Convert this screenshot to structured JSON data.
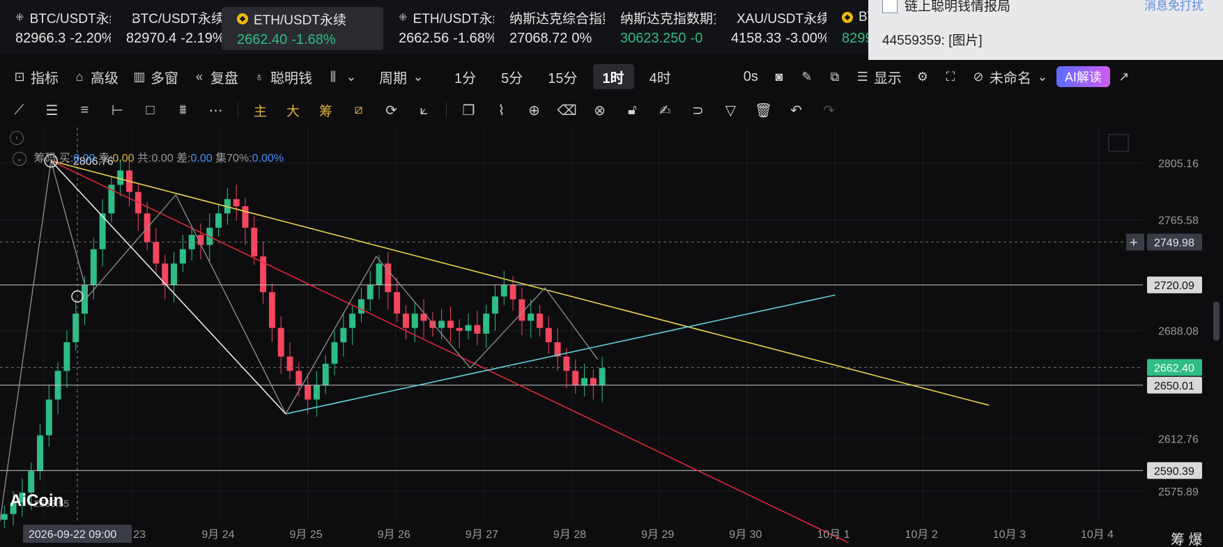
{
  "tickers": [
    {
      "name": "BTC/USDT永续",
      "price": "82966.3",
      "change": "-2.20%",
      "icon": "x-icon"
    },
    {
      "name": "BTC/USDT永续",
      "price": "82970.4",
      "change": "-2.19%",
      "icon": "binance-icon"
    },
    {
      "name": "ETH/USDT永续",
      "price": "2662.40",
      "change": "-1.68%",
      "icon": "binance-icon",
      "active": true
    },
    {
      "name": "ETH/USDT永续",
      "price": "2662.56",
      "change": "-1.68%",
      "icon": "x-icon"
    },
    {
      "name": "纳斯达克综合指数",
      "price": "27068.72",
      "change": "0%",
      "icon": ""
    },
    {
      "name": "纳斯达克指数期货",
      "price": "30623.250",
      "change": "-0",
      "icon": "",
      "green": true
    },
    {
      "name": "XAU/USDT永续",
      "price": "4158.33",
      "change": "-3.00%",
      "icon": "binance-icon"
    },
    {
      "name": "BTC",
      "price": "8299",
      "change": "",
      "icon": "binance-icon",
      "green": true
    }
  ],
  "notification": {
    "title": "链上聪明钱情报局",
    "dismiss": "消息免打扰",
    "body": "44559359: [图片]"
  },
  "toolbar": {
    "indicators": "指标",
    "advanced": "高级",
    "multi_window": "多窗",
    "replay": "复盘",
    "smart_money": "聪明钱",
    "period": "周期",
    "intervals": [
      "1分",
      "5分",
      "15分",
      "1时",
      "4时"
    ],
    "active_interval": "1时",
    "countdown": "0s",
    "display": "显示",
    "unnamed": "未命名",
    "ai_read": "AI解读"
  },
  "toolbar2": {
    "main": "主",
    "big": "大",
    "chips": "筹"
  },
  "chip_line": {
    "label": "筹码",
    "buy_label": "买:",
    "buy": "0.00",
    "sell_label": "卖:",
    "sell": "0.00",
    "total_label": "共:",
    "total": "0.00",
    "diff_label": "差:",
    "diff": "0.00",
    "concentration_label": "集70%:",
    "concentration": "0.00%"
  },
  "logo": "AiCoin",
  "bottom_right": "筹  爆",
  "colors": {
    "up": "#2ebd85",
    "down": "#f6465d",
    "yellow_line": "#e8d44d",
    "red_line": "#e0263a",
    "cyan_line": "#5fd0d8",
    "active_price_bg": "#2ebd85"
  },
  "chart_data": {
    "type": "candlestick",
    "symbol": "ETH/USDT永续",
    "interval": "1时",
    "y_ticks": [
      2805.16,
      2765.58,
      2688.08,
      2612.76,
      2575.89
    ],
    "y_range": [
      2555,
      2830
    ],
    "x_labels": [
      "2026-09-22 09:00",
      "23",
      "9月 24",
      "9月 25",
      "9月 26",
      "9月 27",
      "9月 28",
      "9月 29",
      "9月 30",
      "10月 1",
      "10月 2",
      "10月 3",
      "10月 4"
    ],
    "x_range_days": [
      21.5,
      34.5
    ],
    "high_marker": "2806.76",
    "low_marker": "2565.55",
    "price_tags": [
      {
        "value": "2749.98",
        "style": "crosshair"
      },
      {
        "value": "2720.09",
        "style": "line"
      },
      {
        "value": "2662.40",
        "style": "current"
      },
      {
        "value": "2650.01",
        "style": "line"
      },
      {
        "value": "2590.39",
        "style": "line"
      }
    ],
    "horizontal_lines": [
      2720.09,
      2650.01,
      2590.39
    ],
    "dashed_lines": [
      2749.98,
      2662.4
    ],
    "trend_lines": [
      {
        "color": "yellow",
        "from": [
          22.08,
          2806.76
        ],
        "to": [
          32.75,
          2636
        ]
      },
      {
        "color": "red",
        "from": [
          22.08,
          2806.76
        ],
        "to": [
          31.15,
          2540
        ]
      },
      {
        "color": "cyan",
        "from": [
          24.75,
          2630
        ],
        "to": [
          31.0,
          2713
        ]
      }
    ],
    "pattern_path": [
      [
        21.5,
        2555
      ],
      [
        22.08,
        2806.76
      ],
      [
        22.5,
        2712
      ],
      [
        23.5,
        2783
      ],
      [
        24.75,
        2630
      ],
      [
        25.78,
        2740
      ],
      [
        26.85,
        2662
      ],
      [
        27.7,
        2718
      ],
      [
        28.3,
        2668
      ]
    ],
    "white_leg": [
      [
        22.08,
        2806.76
      ],
      [
        24.75,
        2630
      ]
    ],
    "candles_close": [
      2560,
      2568,
      2575,
      2590,
      2615,
      2640,
      2660,
      2680,
      2700,
      2720,
      2745,
      2770,
      2790,
      2800,
      2785,
      2770,
      2750,
      2735,
      2720,
      2735,
      2745,
      2755,
      2748,
      2760,
      2770,
      2780,
      2775,
      2760,
      2740,
      2715,
      2690,
      2670,
      2660,
      2650,
      2640,
      2650,
      2665,
      2680,
      2690,
      2700,
      2710,
      2720,
      2735,
      2715,
      2700,
      2690,
      2700,
      2695,
      2690,
      2695,
      2690,
      2688,
      2692,
      2686,
      2700,
      2712,
      2720,
      2710,
      2695,
      2700,
      2690,
      2680,
      2670,
      2660,
      2650,
      2655,
      2650,
      2662
    ]
  }
}
